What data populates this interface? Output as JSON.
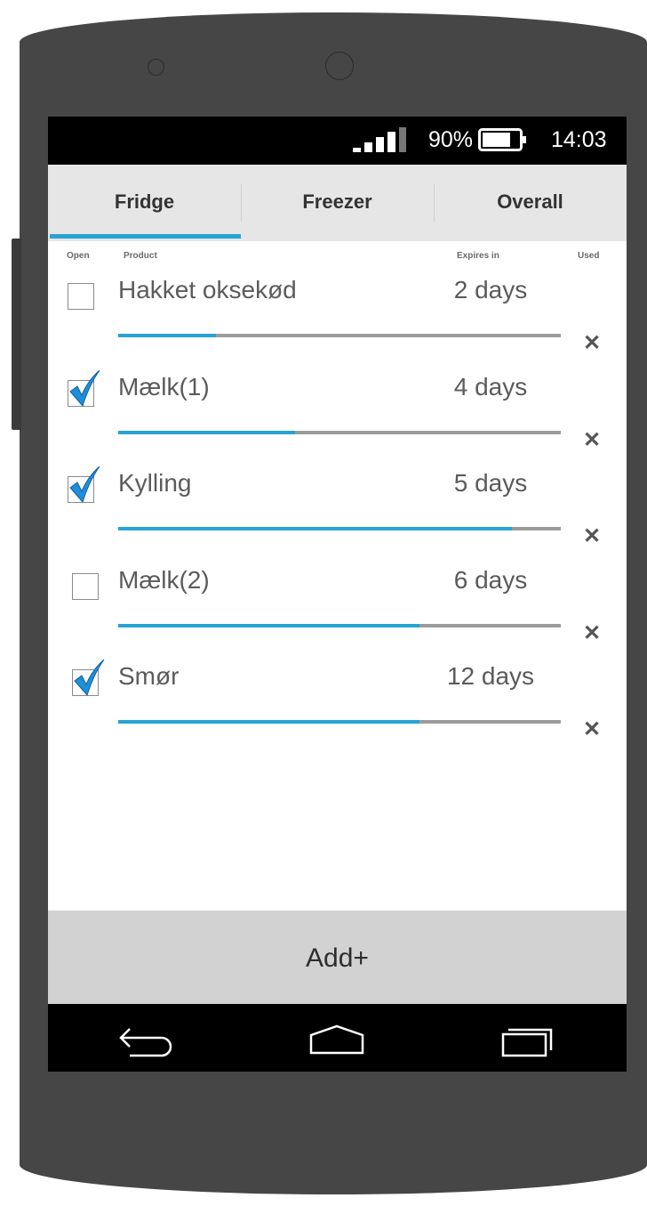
{
  "status_bar": {
    "battery_percent": "90%",
    "time": "14:03",
    "signal_icon": "signal-icon",
    "battery_icon": "battery-icon"
  },
  "tabs": [
    {
      "label": "Fridge",
      "active": true
    },
    {
      "label": "Freezer",
      "active": false
    },
    {
      "label": "Overall",
      "active": false
    }
  ],
  "columns": {
    "open": "Open",
    "product": "Product",
    "expires": "Expires in",
    "used": "Used"
  },
  "items": [
    {
      "name": "Hakket oksekød",
      "expires": "2 days",
      "opened": false,
      "progress": 0.22
    },
    {
      "name": "Mælk(1)",
      "expires": "4 days",
      "opened": true,
      "progress": 0.4
    },
    {
      "name": "Kylling",
      "expires": "5 days",
      "opened": true,
      "progress": 0.89
    },
    {
      "name": "Mælk(2)",
      "expires": "6 days",
      "opened": false,
      "progress": 0.68
    },
    {
      "name": "Smør",
      "expires": "12 days",
      "opened": true,
      "progress": 0.68
    }
  ],
  "add_button": {
    "label": "Add+"
  },
  "colors": {
    "accent": "#27a3d4",
    "track": "#9b9b9b",
    "phone_body": "#464646",
    "tab_bar": "#e6e6e6",
    "add_bar": "#d2d2d2"
  },
  "nav": {
    "back_icon": "back-icon",
    "home_icon": "home-icon",
    "recent_icon": "recent-apps-icon"
  }
}
